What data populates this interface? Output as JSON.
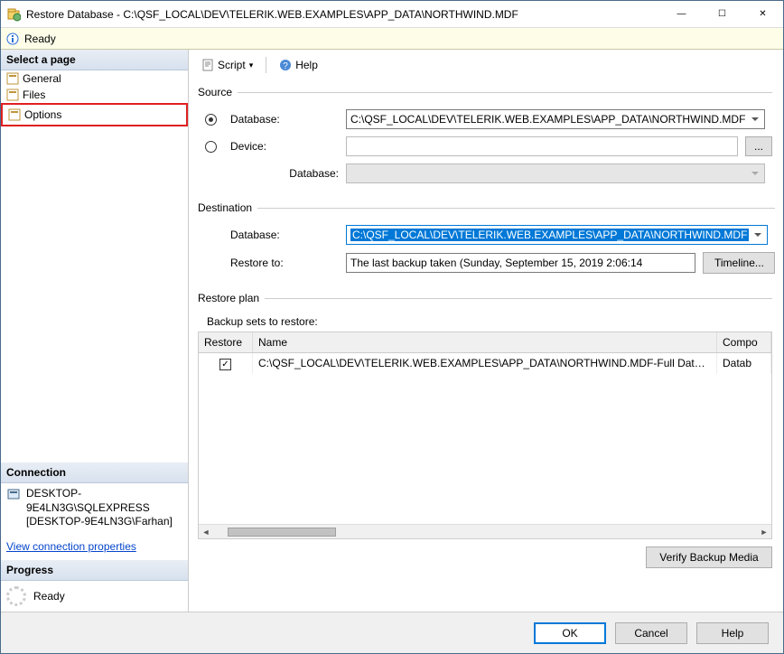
{
  "window": {
    "title": "Restore Database - C:\\QSF_LOCAL\\DEV\\TELERIK.WEB.EXAMPLES\\APP_DATA\\NORTHWIND.MDF"
  },
  "status": {
    "text": "Ready"
  },
  "sidebar": {
    "select_header": "Select a page",
    "items": [
      {
        "label": "General"
      },
      {
        "label": "Files"
      },
      {
        "label": "Options"
      }
    ],
    "connection_header": "Connection",
    "connection": {
      "server": "DESKTOP-9E4LN3G\\SQLEXPRESS",
      "user": "[DESKTOP-9E4LN3G\\Farhan]"
    },
    "view_connection": "View connection properties",
    "progress_header": "Progress",
    "progress_text": "Ready"
  },
  "toolbar": {
    "script": "Script",
    "help": "Help"
  },
  "source": {
    "legend": "Source",
    "database_label": "Database:",
    "database_value": "C:\\QSF_LOCAL\\DEV\\TELERIK.WEB.EXAMPLES\\APP_DATA\\NORTHWIND.MDF",
    "device_label": "Device:",
    "device_browse": "...",
    "device_db_label": "Database:"
  },
  "destination": {
    "legend": "Destination",
    "database_label": "Database:",
    "database_value": "C:\\QSF_LOCAL\\DEV\\TELERIK.WEB.EXAMPLES\\APP_DATA\\NORTHWIND.MDF",
    "restore_to_label": "Restore to:",
    "restore_to_value": "The last backup taken (Sunday, September 15, 2019 2:06:14",
    "timeline_button": "Timeline..."
  },
  "restore_plan": {
    "legend": "Restore plan",
    "subtitle": "Backup sets to restore:",
    "columns": {
      "restore": "Restore",
      "name": "Name",
      "component": "Compo"
    },
    "rows": [
      {
        "checked": "✓",
        "name": "C:\\QSF_LOCAL\\DEV\\TELERIK.WEB.EXAMPLES\\APP_DATA\\NORTHWIND.MDF-Full Database Bac...",
        "component": "Datab"
      }
    ]
  },
  "actions": {
    "verify": "Verify Backup Media",
    "ok": "OK",
    "cancel": "Cancel",
    "help": "Help"
  }
}
